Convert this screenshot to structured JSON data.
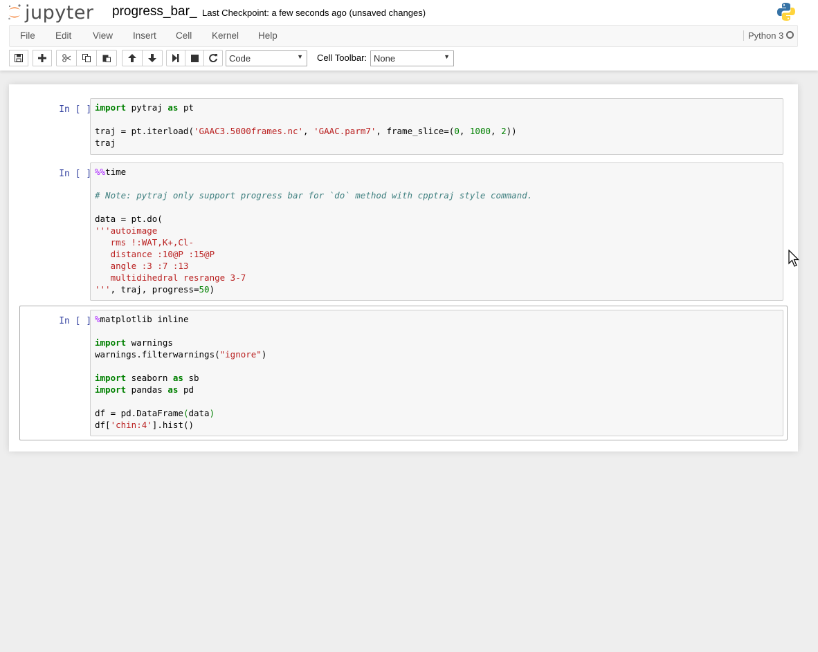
{
  "header": {
    "logo_text": "jupyter",
    "notebook_name": "progress_bar_",
    "checkpoint": "Last Checkpoint: a few seconds ago (unsaved changes)"
  },
  "menu": {
    "items": [
      "File",
      "Edit",
      "View",
      "Insert",
      "Cell",
      "Kernel",
      "Help"
    ],
    "kernel": "Python 3"
  },
  "toolbar": {
    "cell_type": "Code",
    "cell_toolbar_label": "Cell Toolbar:",
    "cell_toolbar_value": "None"
  },
  "cells": [
    {
      "prompt": "In [ ]:",
      "lines": [
        "import pytraj as pt",
        "",
        "traj = pt.iterload('GAAC3.5000frames.nc', 'GAAC.parm7', frame_slice=(0, 1000, 2))",
        "traj"
      ]
    },
    {
      "prompt": "In [ ]:",
      "lines": [
        "%%time",
        "",
        "# Note: pytraj only support progress bar for `do` method with cpptraj style command.",
        "",
        "data = pt.do(",
        "'''autoimage",
        "   rms !:WAT,K+,Cl-",
        "   distance :10@P :15@P",
        "   angle :3 :7 :13",
        "   multidihedral resrange 3-7",
        "''', traj, progress=50)"
      ]
    },
    {
      "prompt": "In [ ]:",
      "lines": [
        "%matplotlib inline",
        "",
        "import warnings",
        "warnings.filterwarnings(\"ignore\")",
        "",
        "import seaborn as sb",
        "import pandas as pd",
        "",
        "df = pd.DataFrame(data)",
        "df['chin:4'].hist()"
      ]
    }
  ],
  "colors": {
    "keyword": "#008000",
    "string": "#ba2121",
    "comment": "#408080",
    "magic": "#aa22ff",
    "prompt": "#303f9f"
  }
}
